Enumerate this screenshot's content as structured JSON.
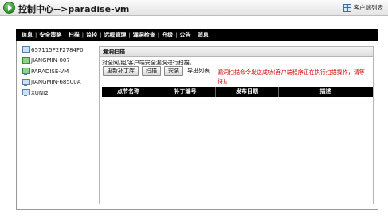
{
  "window": {
    "title": "控制中心-->paradise-vm",
    "right_link": "客户端列表",
    "right_icon": "grid-list-icon"
  },
  "nav": {
    "items": [
      "信息",
      "安全策略",
      "扫描",
      "监控",
      "远程管理",
      "漏洞检查",
      "升级",
      "公告",
      "消息"
    ]
  },
  "tree": {
    "items": [
      {
        "label": "657115F2F2784F0",
        "icon": "computer-icon",
        "active": false
      },
      {
        "label": "JIANGMIN-007",
        "icon": "computer-icon",
        "active": true
      },
      {
        "label": "PARADISE-VM",
        "icon": "computer-icon",
        "active": true
      },
      {
        "label": "JIANGMIN-68500A",
        "icon": "computer-icon",
        "active": false
      },
      {
        "label": "XUNI2",
        "icon": "computer-icon",
        "active": false
      }
    ]
  },
  "panel": {
    "title": "漏洞扫描",
    "description": "对全网/组/客户端安全漏洞进行扫描。",
    "buttons": {
      "update": "更新补丁库",
      "scan": "扫描",
      "install": "安装"
    },
    "export_label": "导出列表",
    "status_message": "漏洞扫描命令发送成功(客户端程序正在执行扫描操作，请等待)。",
    "status_color": "#d00000",
    "table": {
      "columns": [
        "点节名称",
        "补丁编号",
        "发布日期",
        "描述"
      ],
      "rows": []
    }
  }
}
